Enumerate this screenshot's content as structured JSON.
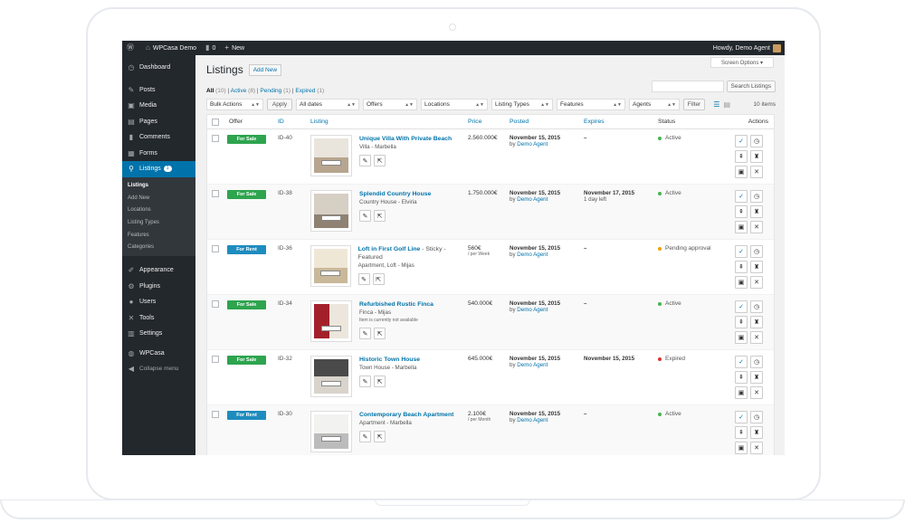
{
  "adminbar": {
    "site_name": "WPCasa Demo",
    "comments_count": "0",
    "new_label": "New",
    "greeting": "Howdy, Demo Agent"
  },
  "sidebar": {
    "items_top": [
      {
        "label": "Dashboard",
        "icon": "dashboard-icon",
        "glyph": "◷"
      }
    ],
    "items_main": [
      {
        "label": "Posts",
        "icon": "pin-icon",
        "glyph": "✎"
      },
      {
        "label": "Media",
        "icon": "media-icon",
        "glyph": "▣"
      },
      {
        "label": "Pages",
        "icon": "page-icon",
        "glyph": "▤"
      },
      {
        "label": "Comments",
        "icon": "comment-icon",
        "glyph": "▮"
      },
      {
        "label": "Forms",
        "icon": "forms-icon",
        "glyph": "▦"
      }
    ],
    "listings": {
      "label": "Listings",
      "count": "1",
      "icon": "location-pin-icon",
      "glyph": "⚲"
    },
    "submenu": [
      "Listings",
      "Add New",
      "Locations",
      "Listing Types",
      "Features",
      "Categories"
    ],
    "items_bottom": [
      {
        "label": "Appearance",
        "icon": "brush-icon",
        "glyph": "✐"
      },
      {
        "label": "Plugins",
        "icon": "plug-icon",
        "glyph": "⚙"
      },
      {
        "label": "Users",
        "icon": "user-icon",
        "glyph": "●"
      },
      {
        "label": "Tools",
        "icon": "wrench-icon",
        "glyph": "✕"
      },
      {
        "label": "Settings",
        "icon": "settings-icon",
        "glyph": "▥"
      }
    ],
    "wpcasa": {
      "label": "WPCasa",
      "icon": "wpcasa-icon",
      "glyph": "◍"
    },
    "collapse": {
      "label": "Collapse menu",
      "icon": "collapse-icon",
      "glyph": "◀"
    }
  },
  "page": {
    "title": "Listings",
    "add_new": "Add New",
    "screen_options": "Screen Options ▾",
    "views": [
      {
        "label": "All",
        "count": "(10)"
      },
      {
        "label": "Active",
        "count": "(8)"
      },
      {
        "label": "Pending",
        "count": "(1)"
      },
      {
        "label": "Expired",
        "count": "(1)"
      }
    ],
    "search_button": "Search Listings",
    "search_placeholder": "",
    "filters": {
      "bulk": "Bulk Actions",
      "apply": "Apply",
      "dates": "All dates",
      "offers": "Offers",
      "locations": "Locations",
      "types": "Listing Types",
      "features": "Features",
      "agents": "Agents",
      "filter": "Filter"
    },
    "items_count": "10 items"
  },
  "table": {
    "headers": {
      "offer": "Offer",
      "id": "ID",
      "listing": "Listing",
      "price": "Price",
      "posted": "Posted",
      "expires": "Expires",
      "status": "Status",
      "actions": "Actions"
    },
    "rows": [
      {
        "offer": "For Sale",
        "offer_type": "sale",
        "id": "ID-40",
        "title": "Unique Villa With Private Beach",
        "sticky": "",
        "sub": "Villa - Marbella",
        "note": "",
        "price": "2.560.000€",
        "price_unit": "",
        "posted_date": "November 15, 2015",
        "posted_by": "by",
        "agent": "Demo Agent",
        "expires": "–",
        "expires_sub": "",
        "status": "Active",
        "status_color": "#46b450"
      },
      {
        "offer": "For Sale",
        "offer_type": "sale",
        "id": "ID-38",
        "title": "Splendid Country House",
        "sticky": "",
        "sub": "Country House - Elviria",
        "note": "",
        "price": "1.750.000€",
        "price_unit": "",
        "posted_date": "November 15, 2015",
        "posted_by": "by",
        "agent": "Demo Agent",
        "expires": "November 17, 2015",
        "expires_sub": "1 day left",
        "status": "Active",
        "status_color": "#46b450"
      },
      {
        "offer": "For Rent",
        "offer_type": "rent",
        "id": "ID-36",
        "title": "Loft in First Golf Line",
        "sticky": " - Sticky - Featured",
        "sub": "Apartment, Loft - Mijas",
        "note": "",
        "price": "560€",
        "price_unit": "/ per Week",
        "posted_date": "November 15, 2015",
        "posted_by": "by",
        "agent": "Demo Agent",
        "expires": "–",
        "expires_sub": "",
        "status": "Pending approval",
        "status_color": "#f0a000"
      },
      {
        "offer": "For Sale",
        "offer_type": "sale",
        "id": "ID-34",
        "title": "Refurbished Rustic Finca",
        "sticky": "",
        "sub": "Finca - Mijas",
        "note": "Item is currently not available",
        "price": "540.000€",
        "price_unit": "",
        "posted_date": "November 15, 2015",
        "posted_by": "by",
        "agent": "Demo Agent",
        "expires": "–",
        "expires_sub": "",
        "status": "Active",
        "status_color": "#46b450"
      },
      {
        "offer": "For Sale",
        "offer_type": "sale",
        "id": "ID-32",
        "title": "Historic Town House",
        "sticky": "",
        "sub": "Town House - Marbella",
        "note": "",
        "price": "645.000€",
        "price_unit": "",
        "posted_date": "November 15, 2015",
        "posted_by": "by",
        "agent": "Demo Agent",
        "expires": "November 15, 2015",
        "expires_sub": "",
        "status": "Expired",
        "status_color": "#dc3232"
      },
      {
        "offer": "For Rent",
        "offer_type": "rent",
        "id": "ID-30",
        "title": "Contemporary Beach Apartment",
        "sticky": "",
        "sub": "Apartment - Marbella",
        "note": "",
        "price": "2.100€",
        "price_unit": "/ per Month",
        "posted_date": "November 15, 2015",
        "posted_by": "by",
        "agent": "Demo Agent",
        "expires": "–",
        "expires_sub": "",
        "status": "Active",
        "status_color": "#46b450"
      }
    ]
  }
}
